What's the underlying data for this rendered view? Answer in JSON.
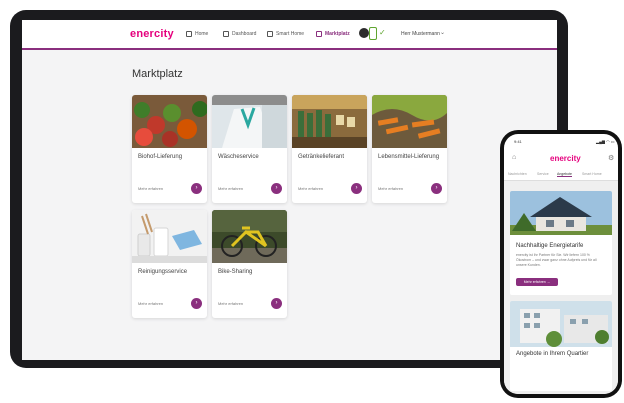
{
  "tablet": {
    "brand": "enercity",
    "nav": [
      {
        "label": "Home",
        "icon": "home-icon"
      },
      {
        "label": "Dashboard",
        "icon": "dashboard-icon"
      },
      {
        "label": "Smart Home",
        "icon": "sliders-icon"
      },
      {
        "label": "Marktplatz",
        "icon": "bag-icon",
        "active": true
      }
    ],
    "user": "Herr Mustermann",
    "page_title": "Marktplatz",
    "cards": [
      {
        "title": "Biohof-Lieferung",
        "more": "Mehr erfahren",
        "image": "vegetables"
      },
      {
        "title": "Wäscheservice",
        "more": "Mehr erfahren",
        "image": "laundry"
      },
      {
        "title": "Getränkelieferant",
        "more": "Mehr erfahren",
        "image": "bottles"
      },
      {
        "title": "Lebensmittel-Lieferung",
        "more": "Mehr erfahren",
        "image": "groceries"
      },
      {
        "title": "Reinigungsservice",
        "more": "Mehr erfahren",
        "image": "cleaning"
      },
      {
        "title": "Bike-Sharing",
        "more": "Mehr erfahren",
        "image": "bike"
      }
    ],
    "colors": {
      "accent": "#8a2f7e",
      "brand": "#e5007d",
      "ok": "#5fa52f"
    }
  },
  "phone": {
    "time": "9:41",
    "status": "▂▄▆ ◠ ▭",
    "brand": "enercity",
    "tabs": [
      "Nachrichten",
      "Service",
      "Angebote",
      "Smart Home"
    ],
    "active_tab": "Angebote",
    "card1": {
      "title": "Nachhaltige Energietarife",
      "text": "enercity ist Ihr Partner für Sie. Wir liefern 100 % Ökostrom – und zwar ganz ohne Aufpreis und für all unsere Kunden.",
      "button": "Mehr erfahren  →"
    },
    "card2": {
      "title": "Angebote in Ihrem Quartier"
    }
  }
}
